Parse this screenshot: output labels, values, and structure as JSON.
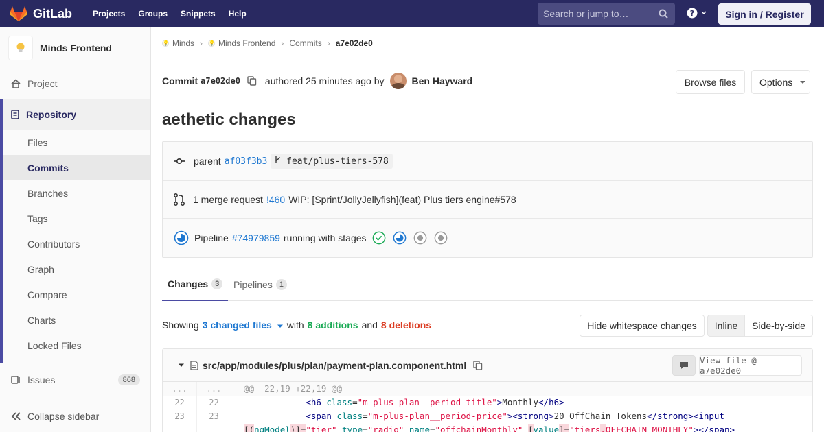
{
  "nav": {
    "brand": "GitLab",
    "links": [
      "Projects",
      "Groups",
      "Snippets",
      "Help"
    ],
    "search_placeholder": "Search or jump to…",
    "signin": "Sign in / Register",
    "brand_color": "#292961"
  },
  "sidebar": {
    "project_name": "Minds Frontend",
    "project_item": "Project",
    "repository": "Repository",
    "items": [
      "Files",
      "Commits",
      "Branches",
      "Tags",
      "Contributors",
      "Graph",
      "Compare",
      "Charts",
      "Locked Files"
    ],
    "active_item": "Commits",
    "issues": "Issues",
    "issues_count": "868",
    "collapse": "Collapse sidebar"
  },
  "breadcrumb": {
    "items": [
      "Minds",
      "Minds Frontend",
      "Commits",
      "a7e02de0"
    ]
  },
  "commit": {
    "label": "Commit",
    "sha": "a7e02de0",
    "authored": "authored 25 minutes ago by",
    "author": "Ben Hayward",
    "browse_files": "Browse files",
    "options": "Options",
    "title": "aethetic changes",
    "parent_label": "parent",
    "parent_sha": "af03f3b3",
    "branch": "feat/plus-tiers-578",
    "mr_label": "1 merge request",
    "mr_id": "!460",
    "mr_title": "WIP: [Sprint/JollyJellyfish](feat) Plus tiers engine#578",
    "pipeline_label": "Pipeline",
    "pipeline_id": "#74979859",
    "pipeline_status": "running with stages"
  },
  "tabs": [
    {
      "label": "Changes",
      "count": "3"
    },
    {
      "label": "Pipelines",
      "count": "1"
    }
  ],
  "diffstat": {
    "showing": "Showing",
    "changed_files": "3 changed files",
    "with": "with",
    "additions": "8 additions",
    "and": "and",
    "deletions": "8 deletions",
    "hide_ws": "Hide whitespace changes",
    "inline": "Inline",
    "side_by_side": "Side-by-side"
  },
  "file": {
    "path": "src/app/modules/plus/plan/payment-plan.component.html",
    "view_file": "View file @ a7e02de0",
    "hunk": "@@ -22,19 +22,19 @@",
    "hunk_marker": "...",
    "lines": [
      {
        "old": "22",
        "new": "22"
      },
      {
        "old": "23",
        "new": "23"
      }
    ]
  }
}
